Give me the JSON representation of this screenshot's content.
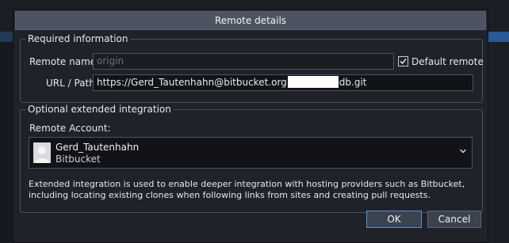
{
  "dialog": {
    "title": "Remote details"
  },
  "required": {
    "legend": "Required information",
    "remote_name_label": "Remote name:",
    "remote_name_placeholder": "origin",
    "default_remote_label": "Default remote",
    "default_remote_checked": true,
    "url_label": "URL / Path:",
    "url_prefix": "https://Gerd_Tautenhahn@bitbucket.org",
    "url_suffix": "db.git"
  },
  "optional": {
    "legend": "Optional extended integration",
    "account_label": "Remote Account:",
    "account_name": "Gerd_Tautenhahn",
    "account_provider": "Bitbucket",
    "info_line1": "Extended integration is used to enable deeper integration with hosting providers such as Bitbucket,",
    "info_line2": "including locating existing clones when following links from sites and creating pull requests."
  },
  "buttons": {
    "ok": "OK",
    "cancel": "Cancel"
  },
  "colors": {
    "dialog_bg": "#1f2228",
    "titlebar_bg": "#4c5462",
    "primary_border": "#5c8fd6"
  }
}
